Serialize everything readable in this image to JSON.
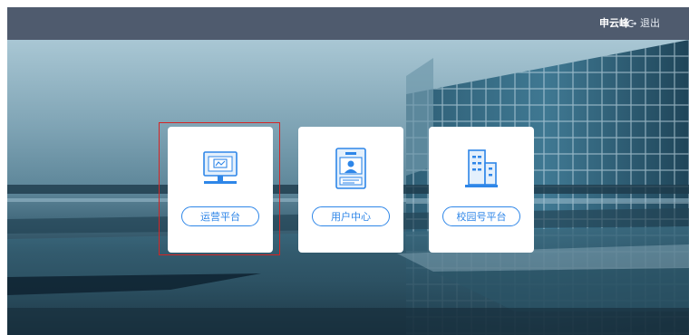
{
  "header": {
    "user_name": "申云峰",
    "logout_label": "退出"
  },
  "cards": [
    {
      "label": "运营平台",
      "icon": "monitor-chart-icon",
      "selected": true
    },
    {
      "label": "用户中心",
      "icon": "id-card-user-icon",
      "selected": false
    },
    {
      "label": "校园号平台",
      "icon": "buildings-icon",
      "selected": false
    }
  ],
  "colors": {
    "topbar": "#4f5b6e",
    "accent": "#2e86e8",
    "selection": "#d32525",
    "card_bg": "#ffffff"
  }
}
